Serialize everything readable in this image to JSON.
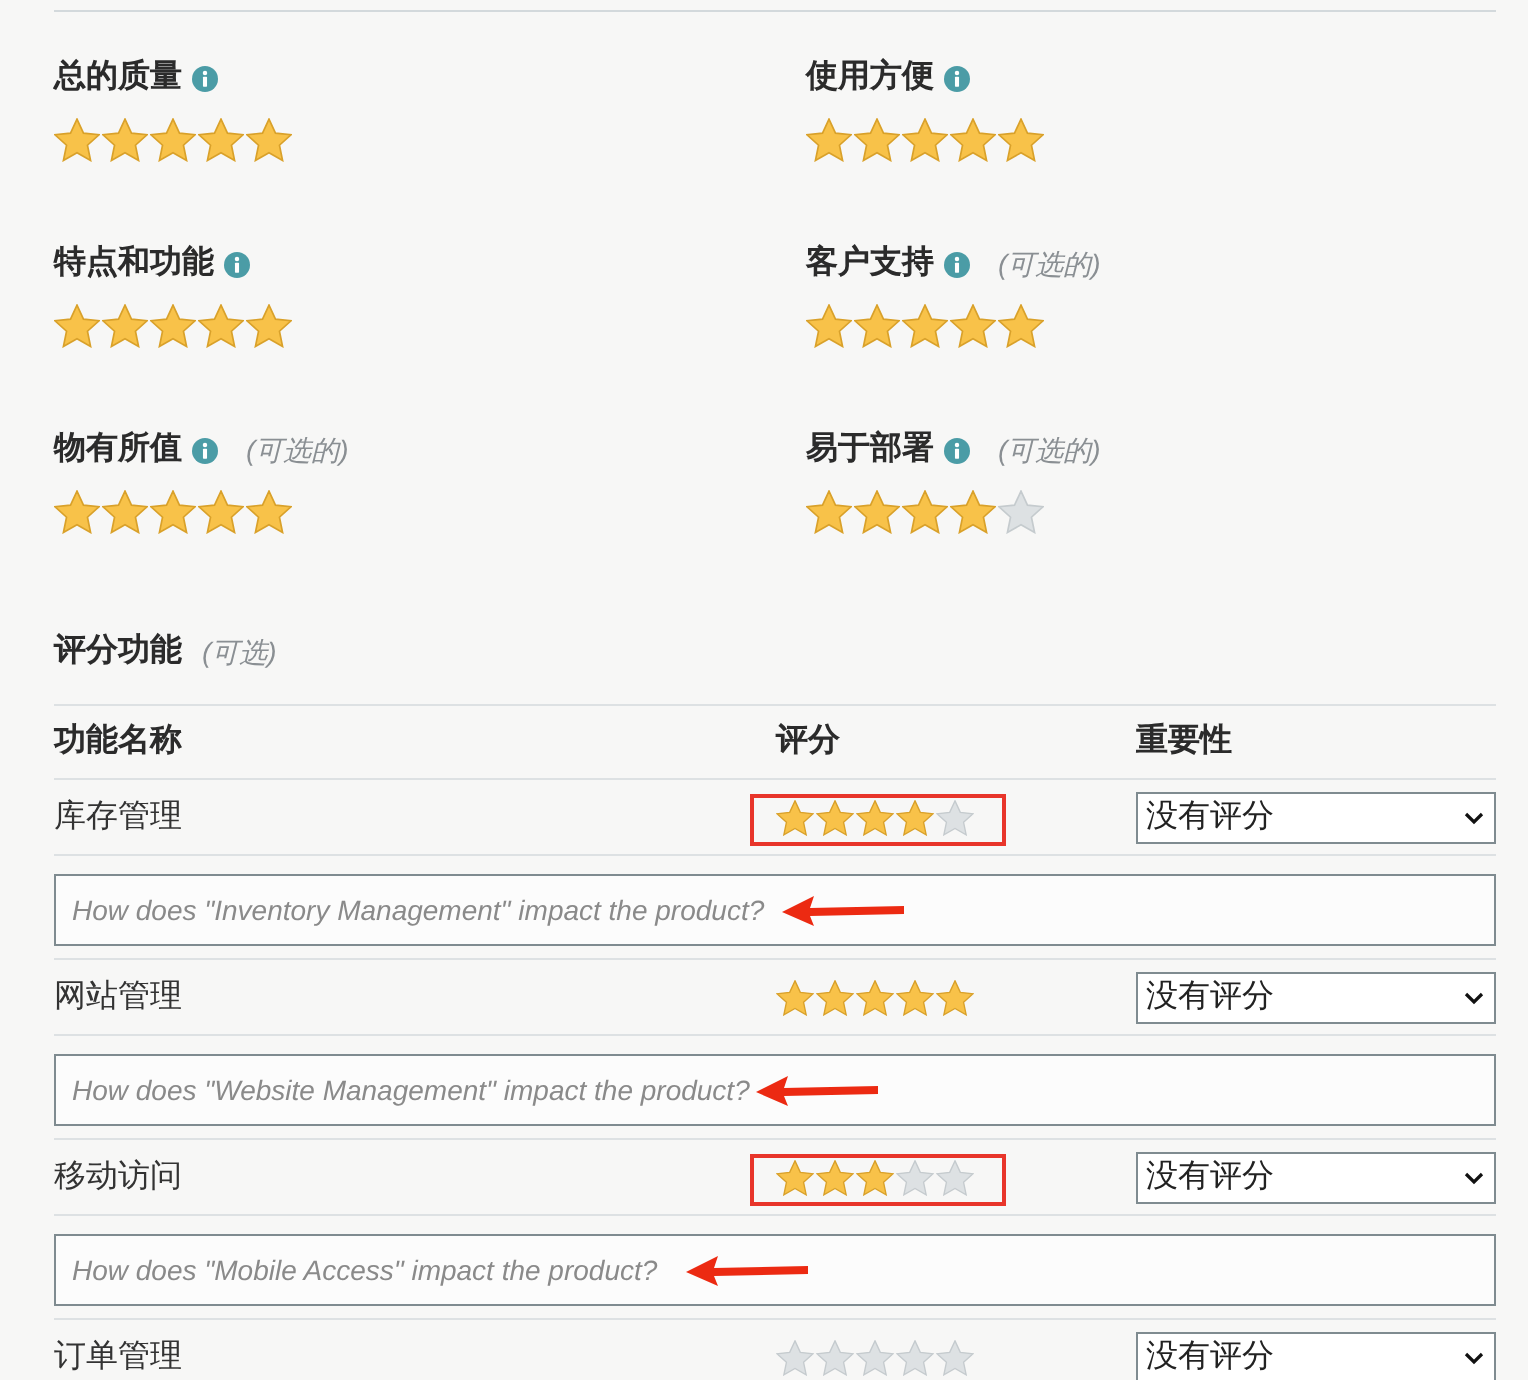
{
  "ratings": [
    {
      "label": "总的质量",
      "stars": 5
    },
    {
      "label": "使用方便",
      "stars": 5
    },
    {
      "label": "特点和功能",
      "stars": 5
    },
    {
      "label": "客户支持",
      "note": "(可选的)",
      "stars": 5
    },
    {
      "label": "物有所值",
      "note": "(可选的)",
      "stars": 5
    },
    {
      "label": "易于部署",
      "note": "(可选的)",
      "stars": 4
    }
  ],
  "features_section": {
    "title": "评分功能",
    "note": "(可选)",
    "columns": [
      "功能名称",
      "评分",
      "重要性"
    ]
  },
  "features": [
    {
      "name": "库存管理",
      "stars": 4,
      "highlighted": true,
      "importance": "没有评分",
      "comment": {
        "placeholder": "How does \"Inventory Management\" impact the product?",
        "arrow": true
      }
    },
    {
      "name": "网站管理",
      "stars": 5,
      "highlighted": false,
      "importance": "没有评分",
      "comment": {
        "placeholder": "How does \"Website Management\" impact the product?",
        "arrow": true
      }
    },
    {
      "name": "移动访问",
      "stars": 3,
      "highlighted": true,
      "importance": "没有评分",
      "comment": {
        "placeholder": "How does \"Mobile Access\" impact the product?",
        "arrow": true
      }
    },
    {
      "name": "订单管理",
      "stars": 0,
      "highlighted": false,
      "importance": "没有评分"
    }
  ]
}
